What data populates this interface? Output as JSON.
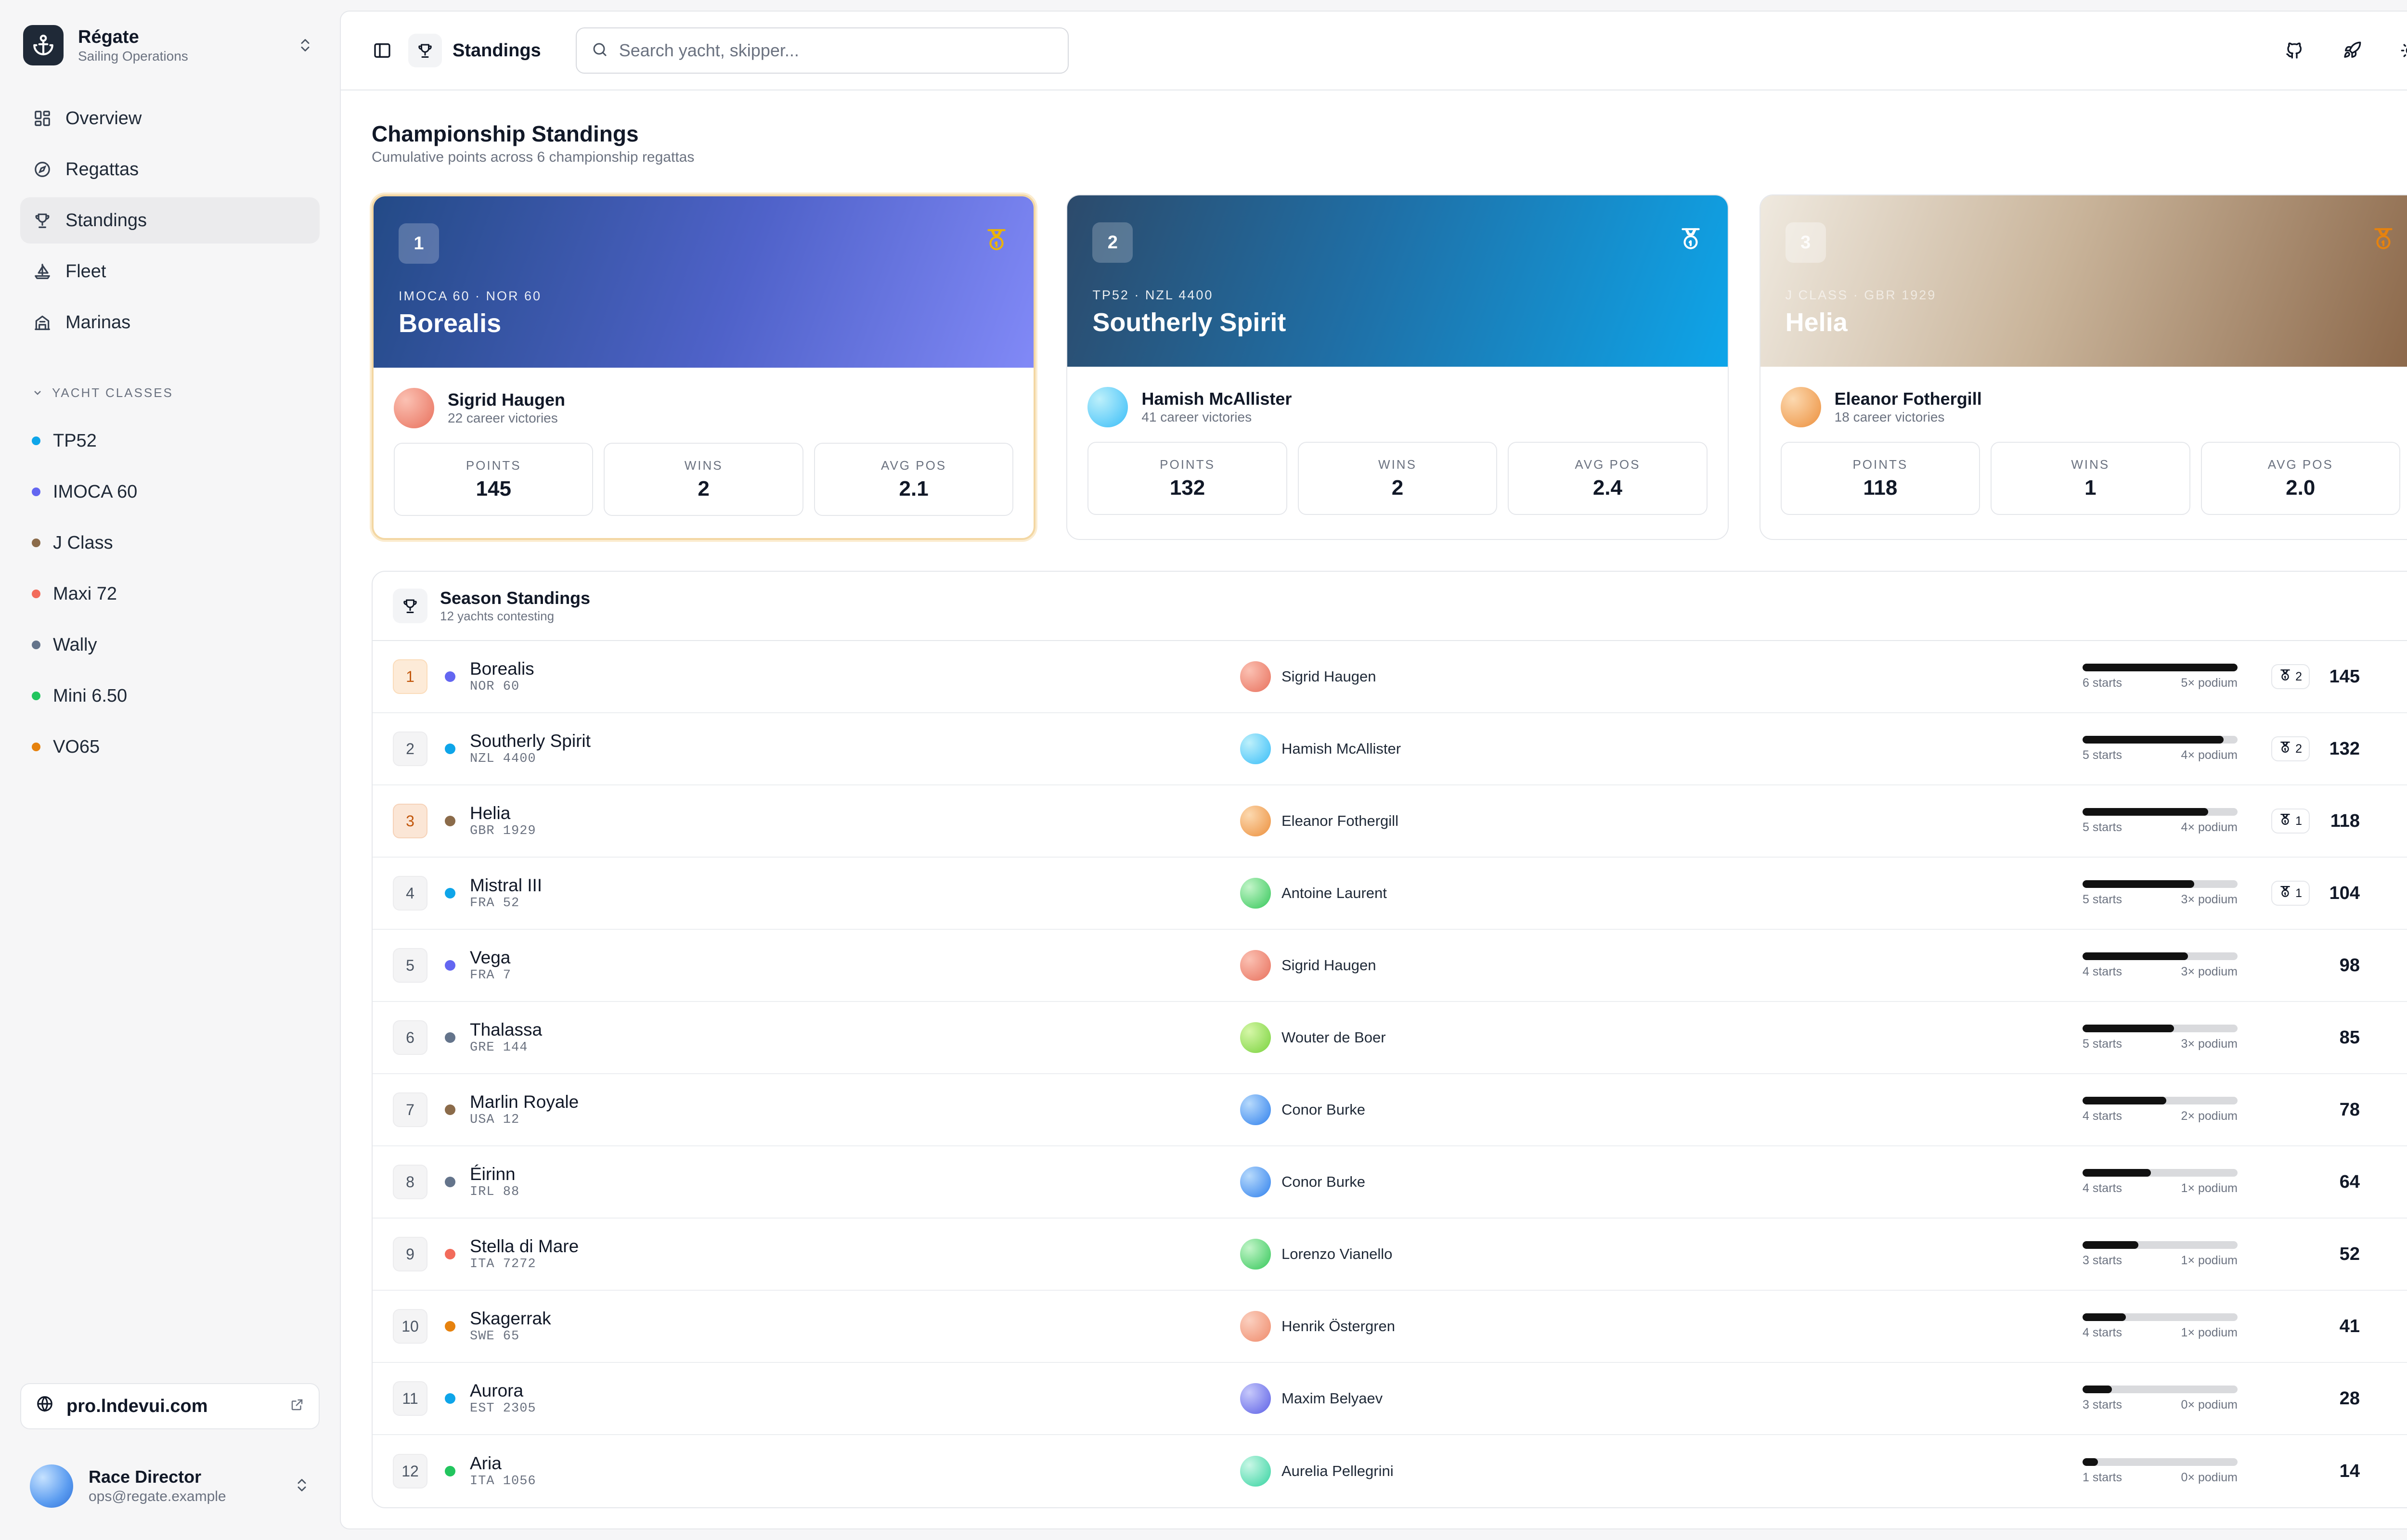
{
  "brand": {
    "name": "Régate",
    "subtitle": "Sailing Operations"
  },
  "nav": [
    {
      "label": "Overview",
      "icon": "grid-icon",
      "active": false
    },
    {
      "label": "Regattas",
      "icon": "compass-icon",
      "active": false
    },
    {
      "label": "Standings",
      "icon": "trophy-icon",
      "active": true
    },
    {
      "label": "Fleet",
      "icon": "sailboat-icon",
      "active": false
    },
    {
      "label": "Marinas",
      "icon": "building-icon",
      "active": false
    }
  ],
  "yacht_classes": {
    "label": "Yacht Classes",
    "items": [
      {
        "label": "TP52",
        "color": "#0ea5e9"
      },
      {
        "label": "IMOCA 60",
        "color": "#6366f1"
      },
      {
        "label": "J Class",
        "color": "#8b6b4a"
      },
      {
        "label": "Maxi 72",
        "color": "#f26b5b"
      },
      {
        "label": "Wally",
        "color": "#64748b"
      },
      {
        "label": "Mini 6.50",
        "color": "#22c55e"
      },
      {
        "label": "VO65",
        "color": "#e6820e"
      }
    ]
  },
  "site_link": "pro.lndevui.com",
  "user": {
    "name": "Race Director",
    "email": "ops@regate.example"
  },
  "topbar": {
    "title": "Standings",
    "search_placeholder": "Search yacht, skipper..."
  },
  "page": {
    "title": "Championship Standings",
    "subtitle": "Cumulative points across 6 championship regattas"
  },
  "podium": [
    {
      "rank": "1",
      "class_line": "IMOCA 60 · NOR 60",
      "name": "Borealis",
      "skipper": "Sigrid Haugen",
      "career": "22 career victories",
      "points_label": "Points",
      "points": "145",
      "wins_label": "Wins",
      "wins": "2",
      "avg_label": "Avg Pos",
      "avg": "2.1",
      "medal_color": "#eab308"
    },
    {
      "rank": "2",
      "class_line": "TP52 · NZL 4400",
      "name": "Southerly Spirit",
      "skipper": "Hamish McAllister",
      "career": "41 career victories",
      "points_label": "Points",
      "points": "132",
      "wins_label": "Wins",
      "wins": "2",
      "avg_label": "Avg Pos",
      "avg": "2.4",
      "medal_color": "#ffffff"
    },
    {
      "rank": "3",
      "class_line": "J Class · GBR 1929",
      "name": "Helia",
      "skipper": "Eleanor Fothergill",
      "career": "18 career victories",
      "points_label": "Points",
      "points": "118",
      "wins_label": "Wins",
      "wins": "1",
      "avg_label": "Avg Pos",
      "avg": "2.0",
      "medal_color": "#e6820e"
    }
  ],
  "standings": {
    "title": "Season Standings",
    "subtitle": "12 yachts contesting",
    "rows": [
      {
        "pos": "1",
        "name": "Borealis",
        "sail": "NOR 60",
        "dot": "#6366f1",
        "skipper": "Sigrid Haugen",
        "avatar": [
          "#fbc1b3",
          "#e8705c"
        ],
        "progress": 1.0,
        "starts": "6 starts",
        "podium": "5× podium",
        "wins": "2",
        "points": "145"
      },
      {
        "pos": "2",
        "name": "Southerly Spirit",
        "sail": "NZL 4400",
        "dot": "#0ea5e9",
        "skipper": "Hamish McAllister",
        "avatar": [
          "#bdf0fb",
          "#38bdf8"
        ],
        "progress": 0.91,
        "starts": "5 starts",
        "podium": "4× podium",
        "wins": "2",
        "points": "132"
      },
      {
        "pos": "3",
        "name": "Helia",
        "sail": "GBR 1929",
        "dot": "#8b6b4a",
        "skipper": "Eleanor Fothergill",
        "avatar": [
          "#fcd9b0",
          "#ec8f3c"
        ],
        "progress": 0.81,
        "starts": "5 starts",
        "podium": "4× podium",
        "wins": "1",
        "points": "118"
      },
      {
        "pos": "4",
        "name": "Mistral III",
        "sail": "FRA 52",
        "dot": "#0ea5e9",
        "skipper": "Antoine Laurent",
        "avatar": [
          "#c3f5c9",
          "#34c759"
        ],
        "progress": 0.72,
        "starts": "5 starts",
        "podium": "3× podium",
        "wins": "1",
        "points": "104"
      },
      {
        "pos": "5",
        "name": "Vega",
        "sail": "FRA 7",
        "dot": "#6366f1",
        "skipper": "Sigrid Haugen",
        "avatar": [
          "#fbc1b3",
          "#e8705c"
        ],
        "progress": 0.68,
        "starts": "4 starts",
        "podium": "3× podium",
        "wins": "",
        "points": "98"
      },
      {
        "pos": "6",
        "name": "Thalassa",
        "sail": "GRE 144",
        "dot": "#64748b",
        "skipper": "Wouter de Boer",
        "avatar": [
          "#d6f7a8",
          "#78d23c"
        ],
        "progress": 0.59,
        "starts": "5 starts",
        "podium": "3× podium",
        "wins": "",
        "points": "85"
      },
      {
        "pos": "7",
        "name": "Marlin Royale",
        "sail": "USA 12",
        "dot": "#8b6b4a",
        "skipper": "Conor Burke",
        "avatar": [
          "#b7dafc",
          "#2f80ed"
        ],
        "progress": 0.54,
        "starts": "4 starts",
        "podium": "2× podium",
        "wins": "",
        "points": "78"
      },
      {
        "pos": "8",
        "name": "Éirinn",
        "sail": "IRL 88",
        "dot": "#64748b",
        "skipper": "Conor Burke",
        "avatar": [
          "#b7dafc",
          "#2f80ed"
        ],
        "progress": 0.44,
        "starts": "4 starts",
        "podium": "1× podium",
        "wins": "",
        "points": "64"
      },
      {
        "pos": "9",
        "name": "Stella di Mare",
        "sail": "ITA 7272",
        "dot": "#f26b5b",
        "skipper": "Lorenzo Vianello",
        "avatar": [
          "#c3f5c9",
          "#34c759"
        ],
        "progress": 0.36,
        "starts": "3 starts",
        "podium": "1× podium",
        "wins": "",
        "points": "52"
      },
      {
        "pos": "10",
        "name": "Skagerrak",
        "sail": "SWE 65",
        "dot": "#e6820e",
        "skipper": "Henrik Östergren",
        "avatar": [
          "#fbd0c0",
          "#ef8a6a"
        ],
        "progress": 0.28,
        "starts": "4 starts",
        "podium": "1× podium",
        "wins": "",
        "points": "41"
      },
      {
        "pos": "11",
        "name": "Aurora",
        "sail": "EST 2305",
        "dot": "#0ea5e9",
        "skipper": "Maxim Belyaev",
        "avatar": [
          "#c7c9fb",
          "#5b5fe6"
        ],
        "progress": 0.19,
        "starts": "3 starts",
        "podium": "0× podium",
        "wins": "",
        "points": "28"
      },
      {
        "pos": "12",
        "name": "Aria",
        "sail": "ITA 1056",
        "dot": "#22c55e",
        "skipper": "Aurelia Pellegrini",
        "avatar": [
          "#c9f7e6",
          "#34d3a0"
        ],
        "progress": 0.1,
        "starts": "1 starts",
        "podium": "0× podium",
        "wins": "",
        "points": "14"
      }
    ]
  }
}
